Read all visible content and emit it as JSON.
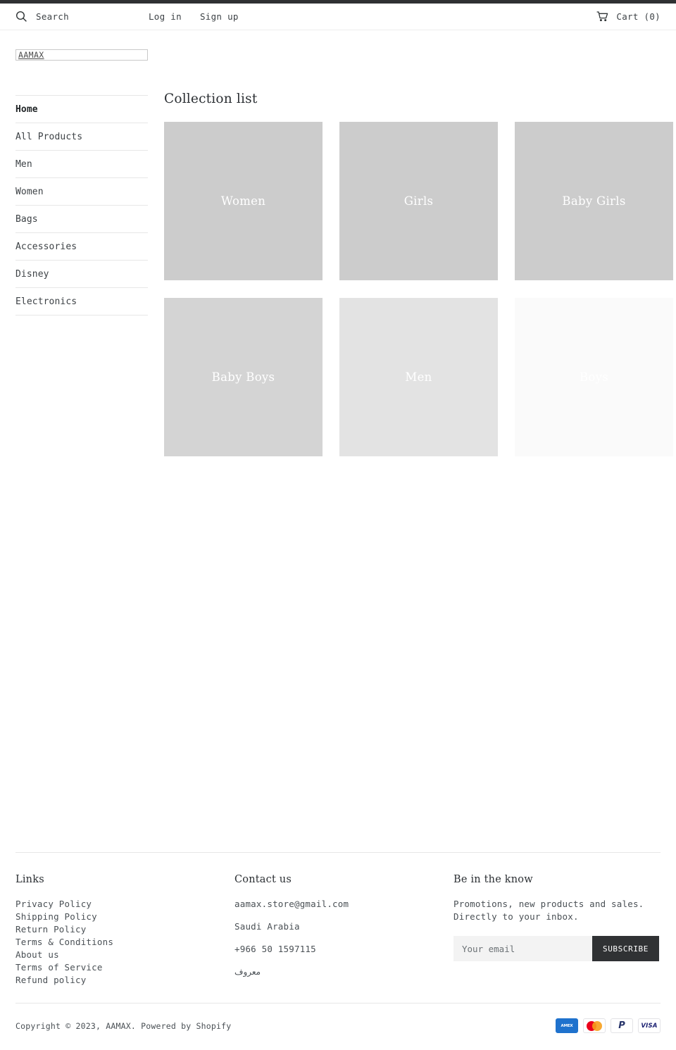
{
  "header": {
    "search_placeholder": "Search",
    "search_label": "Search",
    "login_label": "Log in",
    "signup_label": "Sign up",
    "cart_label": "Cart (0)",
    "search_icon": "search-icon",
    "cart_icon": "cart-icon"
  },
  "brand": {
    "logo_text": "AAMAX"
  },
  "sidebar": {
    "items": [
      {
        "label": "Home",
        "active": true
      },
      {
        "label": "All Products",
        "active": false
      },
      {
        "label": "Men",
        "active": false
      },
      {
        "label": "Women",
        "active": false
      },
      {
        "label": "Bags",
        "active": false
      },
      {
        "label": "Accessories",
        "active": false
      },
      {
        "label": "Disney",
        "active": false
      },
      {
        "label": "Electronics",
        "active": false
      }
    ]
  },
  "main": {
    "title": "Collection list",
    "collections": [
      {
        "label": "Women",
        "bg": "#cccccc"
      },
      {
        "label": "Girls",
        "bg": "#cccccc"
      },
      {
        "label": "Baby Girls",
        "bg": "#cccccc"
      },
      {
        "label": "Baby Boys",
        "bg": "#d4d4d4"
      },
      {
        "label": "Men",
        "bg": "#e3e3e3"
      },
      {
        "label": "Boys",
        "bg": "#fafafa"
      }
    ]
  },
  "footer": {
    "links": {
      "heading": "Links",
      "items": [
        "Privacy Policy",
        "Shipping Policy",
        "Return Policy",
        "Terms & Conditions",
        "About us",
        "Terms of Service",
        "Refund policy"
      ]
    },
    "contact": {
      "heading": "Contact us",
      "email": "aamax.store@gmail.com",
      "country": "Saudi Arabia",
      "phone": "+966 50 1597115",
      "arabic": "معروف"
    },
    "newsletter": {
      "heading": "Be in the know",
      "text_line1": "Promotions, new products and sales.",
      "text_line2": "Directly to your inbox.",
      "input_placeholder": "Your email",
      "input_value": "",
      "button_label": "SUBSCRIBE"
    }
  },
  "bottom": {
    "copyright": "Copyright © 2023, AAMAX. Powered by Shopify",
    "payments": [
      {
        "name": "amex-icon",
        "label": "AMEX"
      },
      {
        "name": "mastercard-icon",
        "label": ""
      },
      {
        "name": "paypal-icon",
        "label": "P"
      },
      {
        "name": "visa-icon",
        "label": "VISA"
      }
    ]
  },
  "colors": {
    "accent_dark": "#303234",
    "text": "#3d4246",
    "border": "#e7e7e7"
  }
}
